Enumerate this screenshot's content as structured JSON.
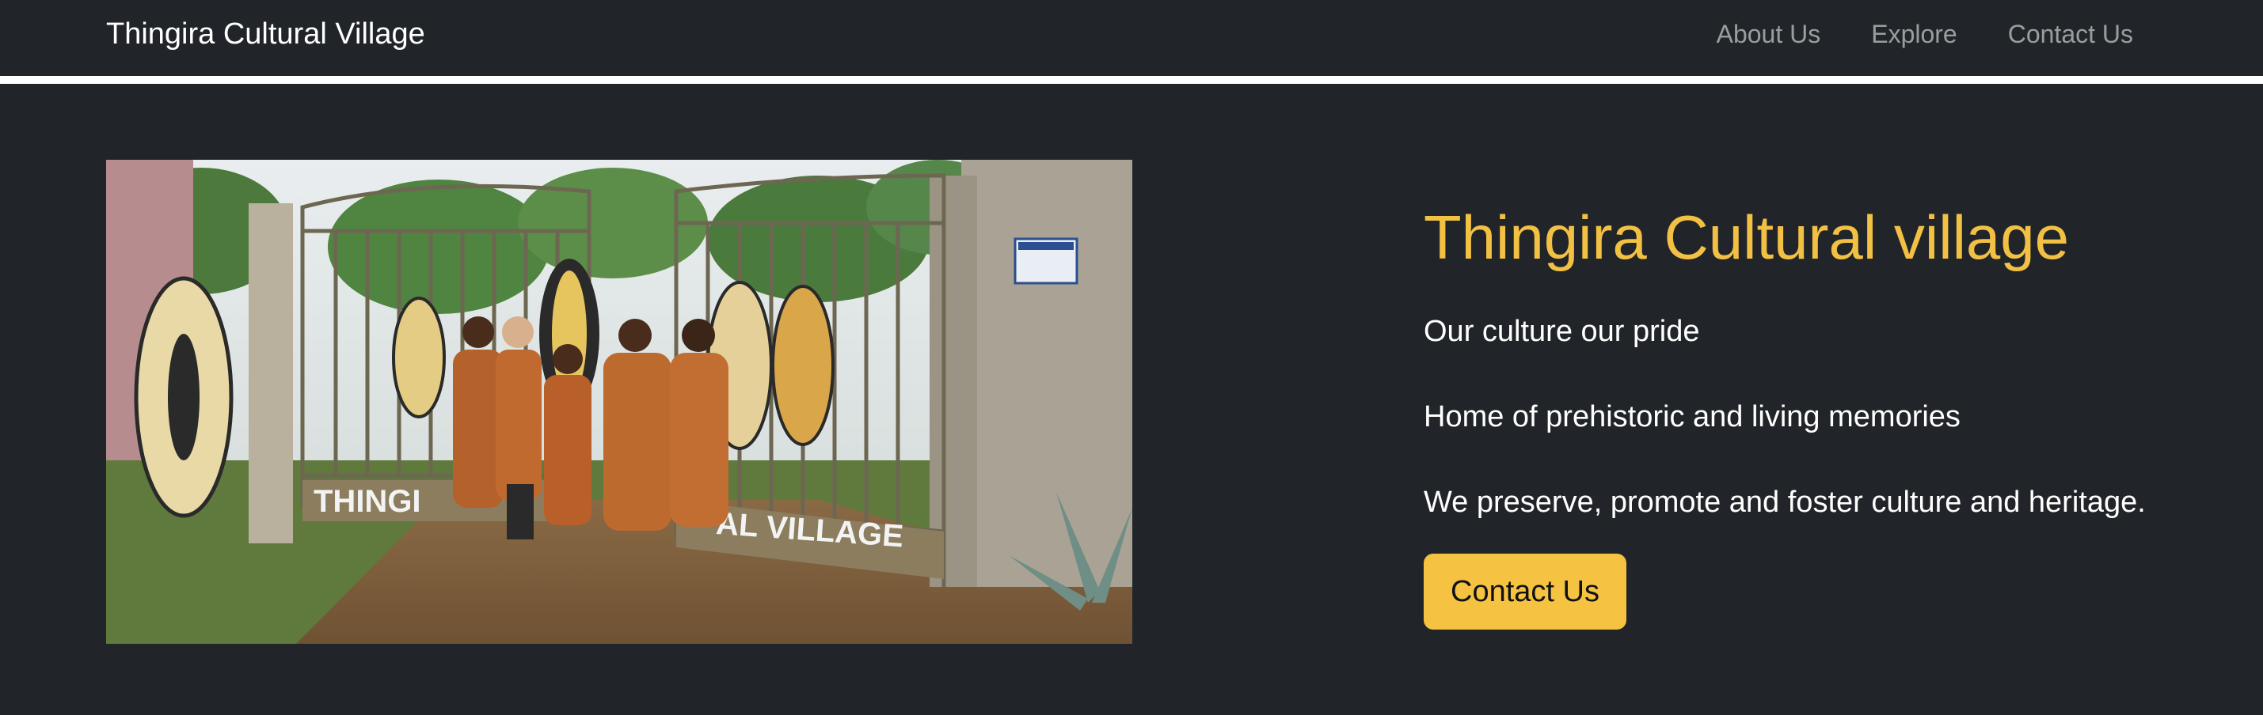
{
  "navbar": {
    "brand": "Thingira Cultural Village",
    "links": [
      {
        "label": "About Us"
      },
      {
        "label": "Explore"
      },
      {
        "label": "Contact Us"
      }
    ]
  },
  "hero": {
    "image_alt": "Women in traditional orange dress standing at the Thingira Cultural Village gate",
    "gate_lettering": [
      "THINGI",
      "AL VILLAGE"
    ],
    "title": "Thingira Cultural village",
    "lines": [
      "Our culture our pride",
      "Home of prehistoric and living memories",
      "We preserve, promote and foster culture and heritage."
    ],
    "cta_label": "Contact Us"
  },
  "colors": {
    "background": "#212529",
    "accent": "#f2c043",
    "button": "#f5c242",
    "nav_link": "rgba(255,255,255,0.55)"
  }
}
